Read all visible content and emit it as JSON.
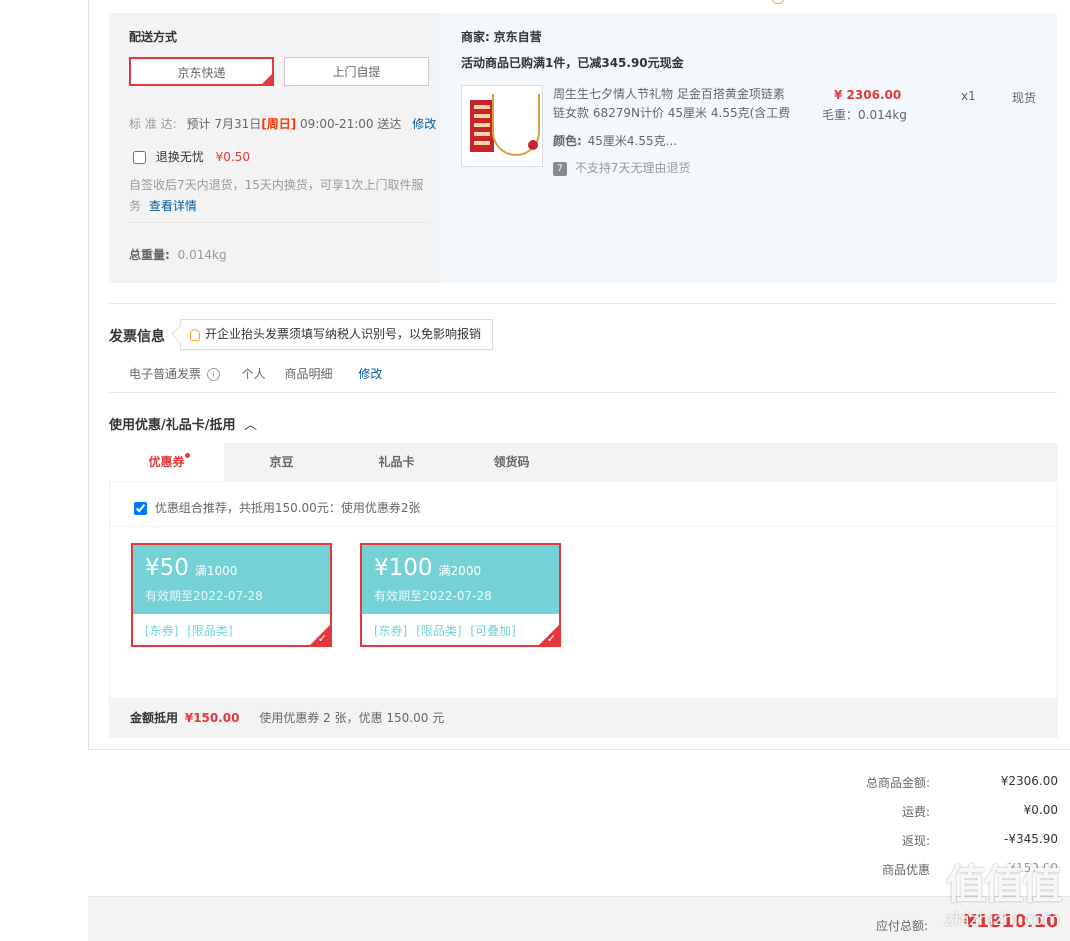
{
  "shipping": {
    "title": "配送方式",
    "options": [
      "京东快递",
      "上门自提"
    ],
    "delivery_label": "标 准 达:",
    "delivery_prefix": "预计 7月31日",
    "delivery_day": "[周日]",
    "delivery_suffix": " 09:00-21:00 送达",
    "modify": "修改",
    "insurance_label": "退换无忧",
    "insurance_price": "¥0.50",
    "insurance_desc": "自签收后7天内退货，15天内换货，可享1次上门取件服务",
    "insurance_link": "查看详情",
    "weight_label": "总重量:",
    "weight_value": "0.014kg"
  },
  "merchant": {
    "label": "商家:",
    "name": "京东自营",
    "promo": "活动商品已购满1件，已减345.90元现金"
  },
  "product": {
    "title": "周生生七夕情人节礼物 足金百搭黄金项链素链女款 68279N计价 45厘米 4.55克(含工费",
    "price": "¥ 2306.00",
    "weight": "毛重：0.014kg",
    "qty": "x1",
    "stock": "现货",
    "color_label": "颜色:",
    "color_value": "45厘米4.55克...",
    "return_icon": "7",
    "return_note": "不支持7天无理由退货"
  },
  "invoice": {
    "title": "发票信息",
    "tip": "开企业抬头发票须填写纳税人识别号，以免影响报销",
    "type": "电子普通发票",
    "person": "个人",
    "detail": "商品明细",
    "modify": "修改"
  },
  "discount": {
    "title": "使用优惠/礼品卡/抵用",
    "toggle": "︿",
    "tabs": [
      "优惠券",
      "京豆",
      "礼品卡",
      "领货码"
    ],
    "combo_text": "优惠组合推荐，共抵用150.00元：使用优惠券2张",
    "coupons": [
      {
        "amount": "¥50",
        "condition": "满1000",
        "expiry": "有效期至2022-07-28",
        "tags": [
          "[东券]",
          "[限品类]"
        ]
      },
      {
        "amount": "¥100",
        "condition": "满2000",
        "expiry": "有效期至2022-07-28",
        "tags": [
          "[东券]",
          "[限品类]",
          "[可叠加]"
        ]
      }
    ],
    "sum_label": "金额抵用",
    "sum_value": "¥150.00",
    "sum_desc": "使用优惠券 2 张，优惠 150.00 元"
  },
  "totals": [
    {
      "label": "总商品金额:",
      "value": "¥2306.00"
    },
    {
      "label": "运费:",
      "value": "¥0.00"
    },
    {
      "label": "返现:",
      "value": "-¥345.90"
    },
    {
      "label": "商品优惠",
      "value": "-¥150.00"
    }
  ],
  "footer": {
    "label": "应付总额:",
    "value": "¥1810.10"
  },
  "watermark": {
    "text1": "值值值",
    "text2": "zhizhizhi.com"
  },
  "colors": {
    "accent": "#e4393c",
    "coupon": "#74d2d7",
    "link": "#005ea7"
  }
}
